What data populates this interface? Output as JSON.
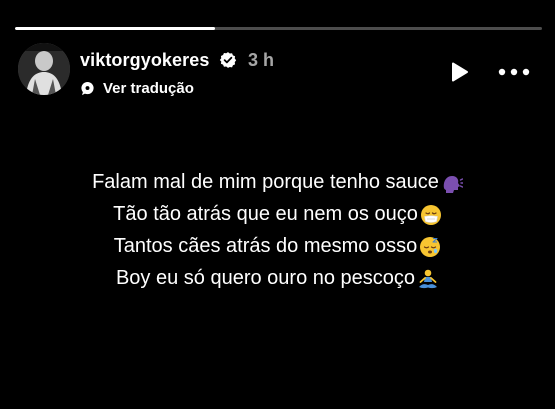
{
  "story": {
    "progress_fraction": 0.38
  },
  "header": {
    "username": "viktorgyokeres",
    "verified_icon": "verified-badge-icon",
    "time_ago": "3 h",
    "translate_icon": "translate-bubble-icon",
    "translate_label": "Ver tradução",
    "play_icon": "play-icon",
    "more_icon": "more-horizontal-icon"
  },
  "lyrics": [
    {
      "text": "Falam mal de mim porque tenho sauce",
      "emoji": "speaking-head-emoji"
    },
    {
      "text": "Tão tão atrás que eu nem os ouço",
      "emoji": "face-with-medical-mask-emoji"
    },
    {
      "text": "Tantos cães atrás do mesmo osso",
      "emoji": "sleeping-face-emoji"
    },
    {
      "text": "Boy eu só quero ouro no pescoço",
      "emoji": "person-in-lotus-position-emoji"
    }
  ],
  "colors": {
    "background": "#000000",
    "text": "#ffffff",
    "muted": "#a6a6a6",
    "emoji_yellow": "#f7c531",
    "speaking_head": "#7b4fb0"
  }
}
